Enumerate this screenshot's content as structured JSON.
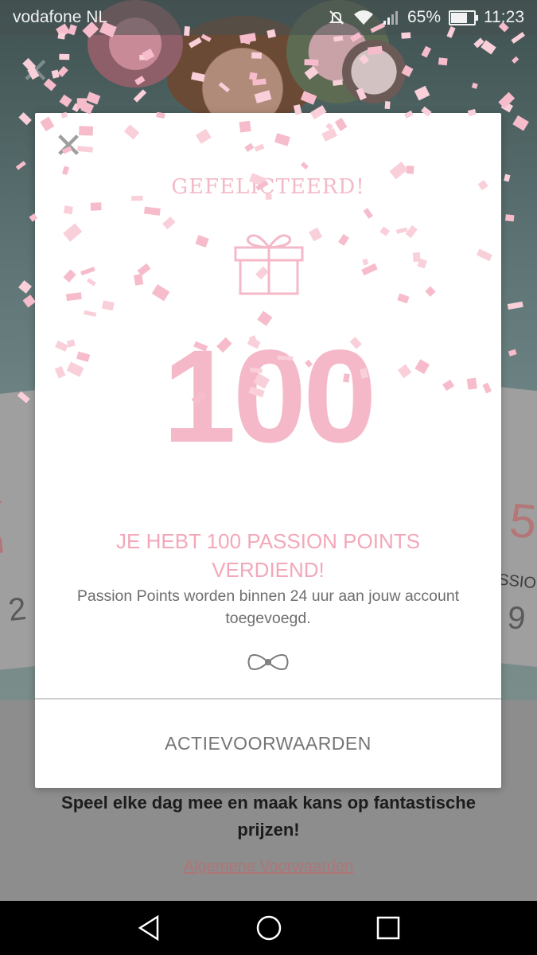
{
  "status_bar": {
    "carrier": "vodafone NL",
    "battery": "65%",
    "time": "11:23",
    "icons": [
      "mute-icon",
      "wifi-icon",
      "signal-icon",
      "battery-icon"
    ]
  },
  "background": {
    "card_left_text": "ar\nm",
    "card_left_number": "2",
    "card_right_text": "5",
    "card_right_sub": "ASSIO",
    "card_right_number": "9",
    "promo_text": "Speel elke dag mee en maak kans op fantastische prijzen!",
    "terms_link": "Algemene Voorwaarden"
  },
  "modal": {
    "title": "GEFELICTEERD!",
    "points": "100",
    "headline": "JE HEBT 100 PASSION POINTS VERDIEND!",
    "subtext": "Passion Points worden binnen 24 uur aan jouw account toegevoegd.",
    "terms_button": "ACTIEVOORWAARDEN",
    "close_icon": "close-icon",
    "gift_icon": "gift-icon",
    "bow_icon": "bow-icon"
  },
  "colors": {
    "accent_pink": "#f4b8c8",
    "headline_pink": "#f2a8b9",
    "text_gray": "#6e6e6e"
  },
  "nav_bar": {
    "icons": [
      "back-icon",
      "home-icon",
      "recents-icon"
    ]
  }
}
